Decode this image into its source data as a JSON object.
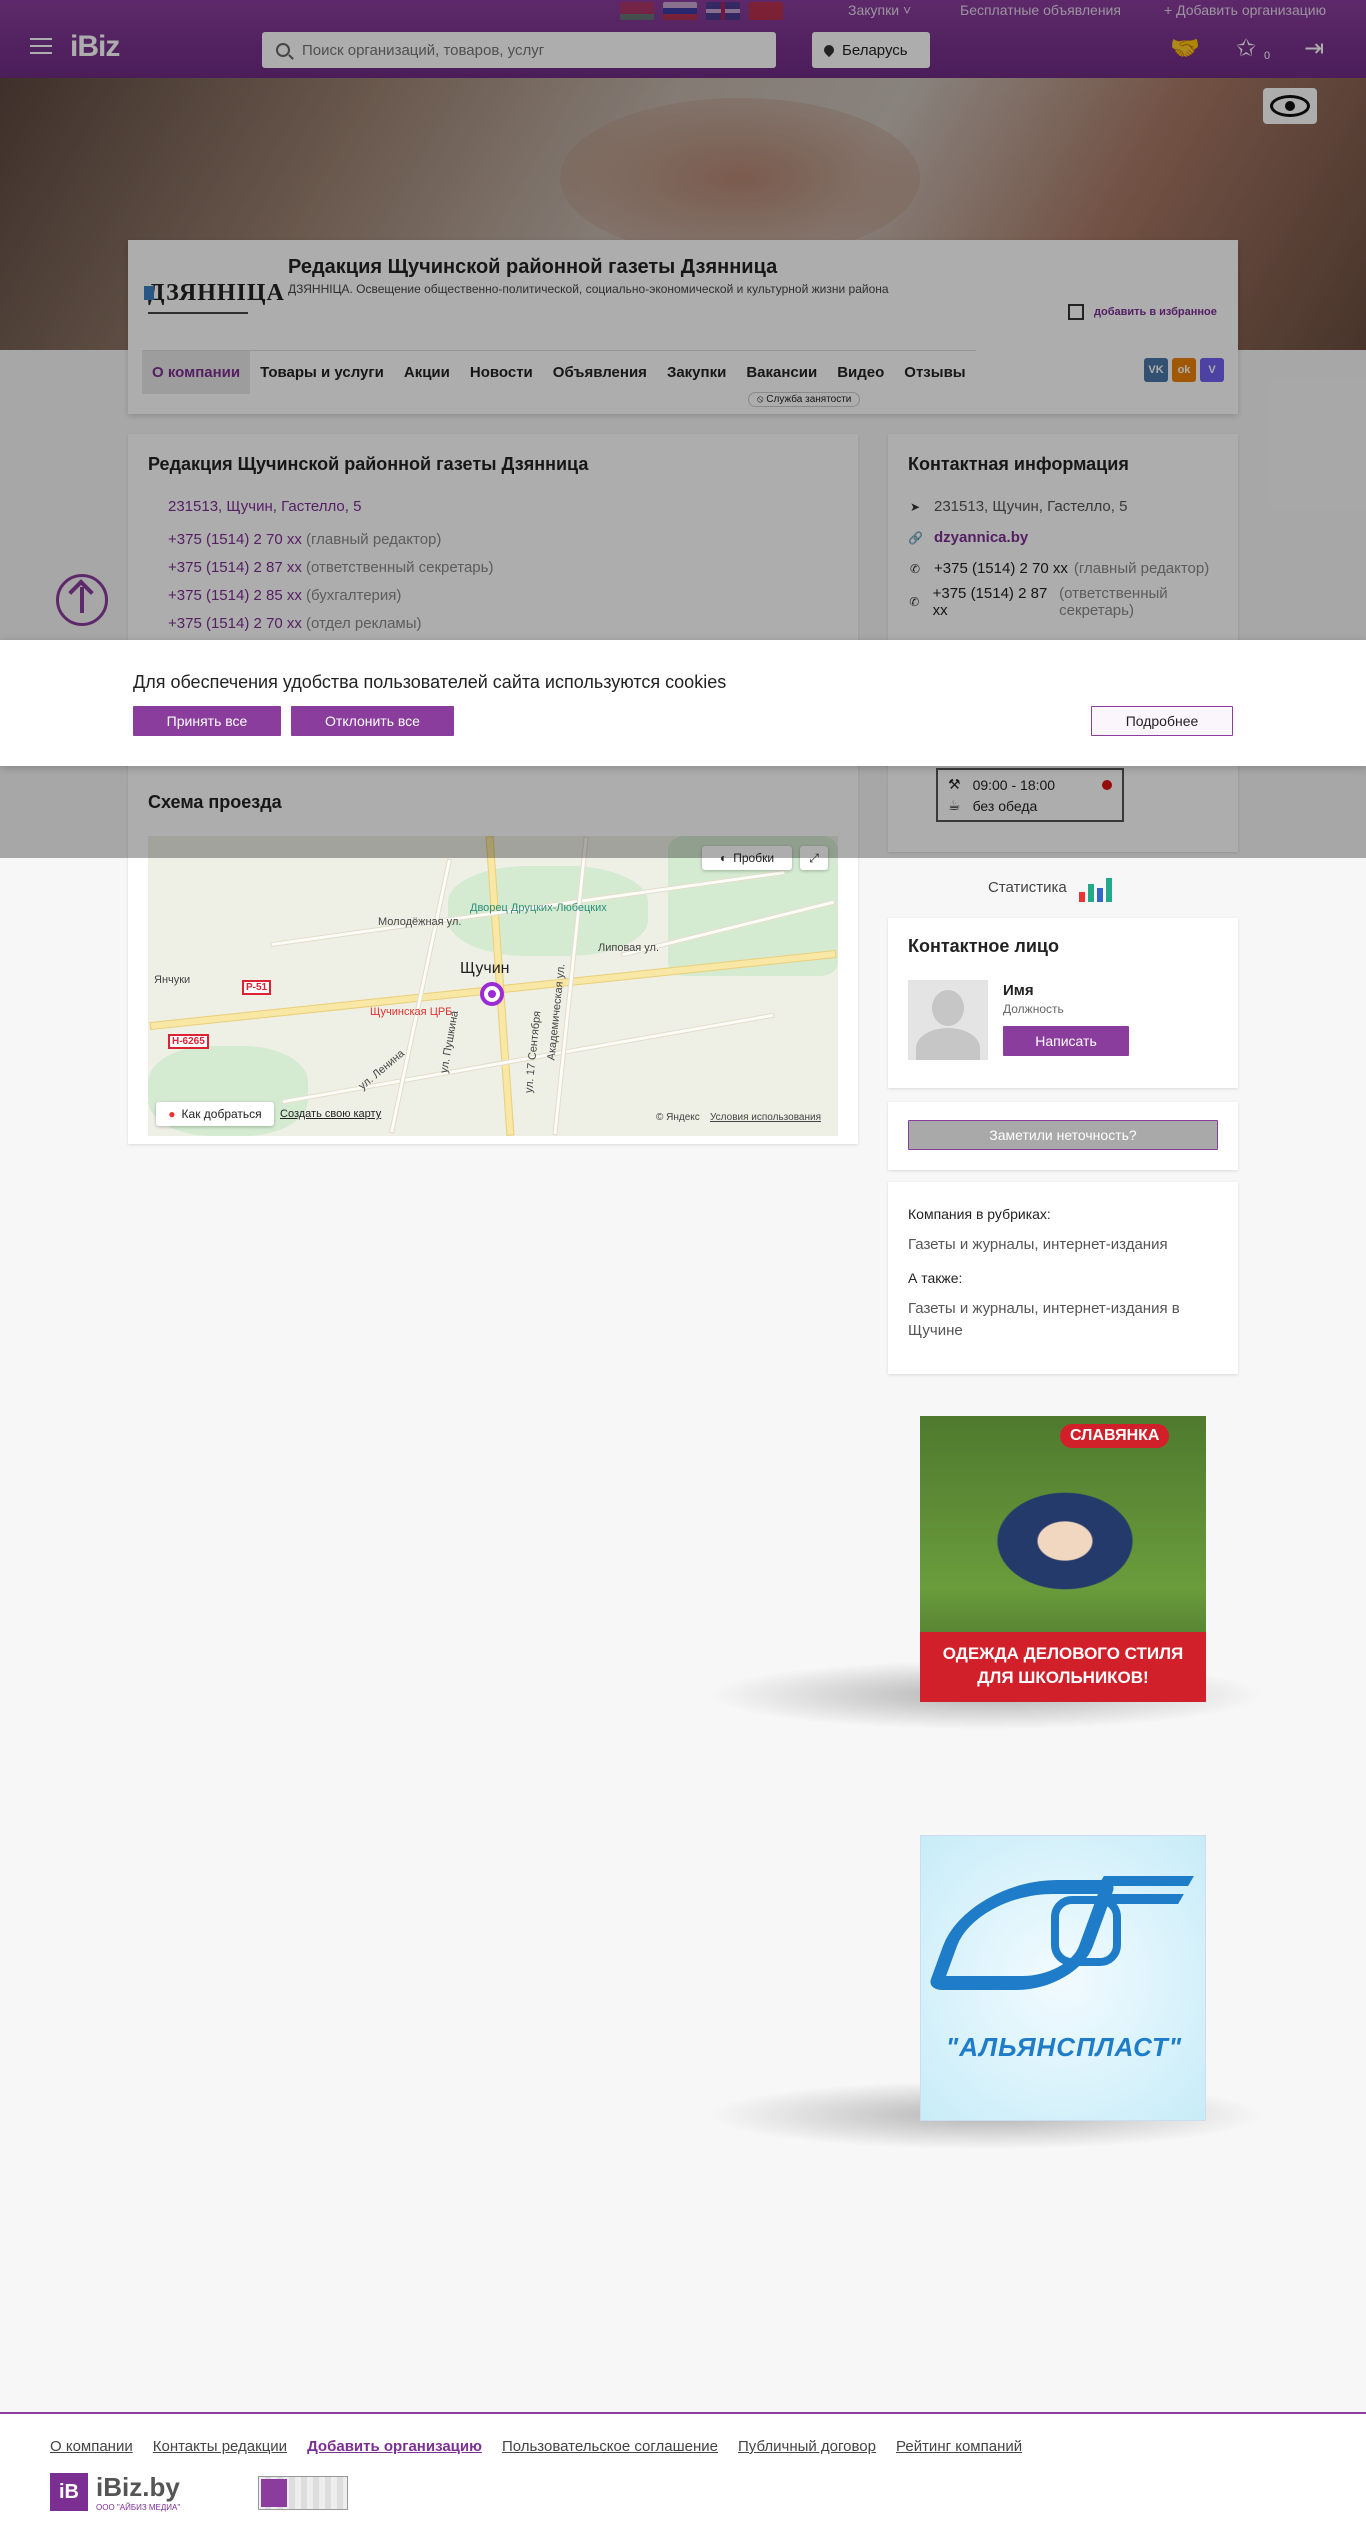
{
  "header": {
    "logo": "iBiz",
    "top_links": {
      "purchases": "Закупки",
      "free_ads": "Бесплатные объявления",
      "add_org": "+ Добавить организацию"
    },
    "search_placeholder": "Поиск организаций, товаров, услуг",
    "region": "Беларусь",
    "star_count": "0"
  },
  "company": {
    "logo_text": "ДЗЯННІЦА",
    "title": "Редакция Щучинской районной газеты Дзянница",
    "subtitle": "ДЗЯННІЦА. Освещение общественно-политической, социально-экономической и культурной жизни района",
    "favorite": "добавить в избранное",
    "nav": [
      "О компании",
      "Товары и услуги",
      "Акции",
      "Новости",
      "Объявления",
      "Закупки",
      "Вакансии",
      "Видео",
      "Отзывы"
    ],
    "nav_badge": "⦸ Служба занятости",
    "socials": [
      "VK",
      "ok",
      "V"
    ]
  },
  "main": {
    "title": "Редакция Щучинской районной газеты Дзянница",
    "address": "231513, Щучин, Гастелло, 5",
    "phones": [
      {
        "number": "+375 (1514) 2 70 xx",
        "note": "(главный редактор)"
      },
      {
        "number": "+375 (1514) 2 87 xx",
        "note": "(ответственный секретарь)"
      },
      {
        "number": "+375 (1514) 2 85 xx",
        "note": "(бухгалтерия)"
      },
      {
        "number": "+375 (1514) 2 70 xx",
        "note": "(отдел рекламы)"
      }
    ],
    "map_title": "Схема проезда",
    "map": {
      "traffic": "Пробки",
      "route": "Как добраться",
      "create": "Создать свою карту",
      "copyright": "© Яндекс",
      "terms": "Условия использования",
      "city": "Щучин",
      "labels": [
        "Дворец Друцких-Любецких",
        "Янчуки",
        "Щучинская ЦРБ",
        "Молодёжная ул.",
        "Липовая ул.",
        "ул. Ленина",
        "ул. Пушкина",
        "ул. 17 Сентября",
        "Академическая ул."
      ],
      "signs": [
        "Р-51",
        "Н-6265"
      ]
    }
  },
  "contacts": {
    "title": "Контактная информация",
    "address": "231513, Щучин, Гастелло, 5",
    "site": "dzyannica.by",
    "phones": [
      {
        "number": "+375 (1514) 2 70 xx",
        "note": "(главный редактор)"
      },
      {
        "number": "+375 (1514) 2 87 xx",
        "note": "(ответственный секретарь)"
      }
    ],
    "hours": "09:00 - 18:00",
    "lunch": "без обеда"
  },
  "statistics": "Статистика",
  "person": {
    "title": "Контактное лицо",
    "name": "Имя",
    "role": "Должность",
    "write": "Написать"
  },
  "report_button": "Заметили неточность?",
  "rubrics": {
    "heading": "Компания в рубриках:",
    "value": "Газеты и журналы, интернет-издания",
    "also_heading": "А также:",
    "also_value": "Газеты и журналы, интернет-издания в Щучине"
  },
  "ads": {
    "ad1_brand": "СЛАВЯНКА",
    "ad1_text": "ОДЕЖДА ДЕЛОВОГО СТИЛЯ ДЛЯ ШКОЛЬНИКОВ!",
    "ad2_brand": "\"АЛЬЯНСПЛАСТ\""
  },
  "cookie": {
    "text": "Для обеспечения удобства пользователей сайта используются cookies",
    "accept": "Принять все",
    "decline": "Отклонить все",
    "more": "Подробнее"
  },
  "footer": {
    "links": [
      "О компании",
      "Контакты редакции",
      "Добавить организацию",
      "Пользовательское соглашение",
      "Публичный договор",
      "Рейтинг компаний"
    ],
    "logo": "iBiz.by",
    "logo_box": "iB",
    "company": "ООО \"АЙБИЗ МЕДИА\""
  },
  "colors": {
    "brand": "#8a3d9c",
    "accent_text": "#7c2f93"
  }
}
